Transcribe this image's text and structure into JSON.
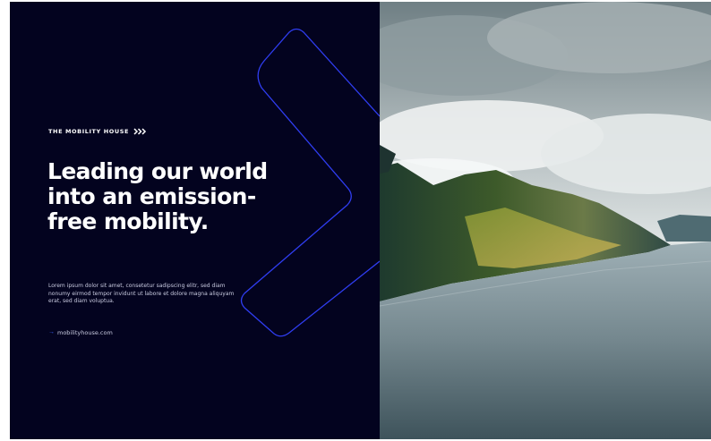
{
  "brand": {
    "name": "THE MOBILITY HOUSE",
    "logo_icon": "triple-chevron-icon"
  },
  "hero": {
    "headline": "Leading our world into an emission-free mobility.",
    "body": "Lorem ipsum dolor sit amet, consetetur sadipscing elitr, sed diam nonumy eirmod tempor invidunt ut labore et dolore magna aliquyam erat, sed diam voluptua."
  },
  "link": {
    "arrow_icon": "arrow-right-icon",
    "text": "mobilityhouse.com"
  },
  "photo": {
    "subject": "fjord-landscape-image"
  },
  "colors": {
    "panel_background": "#03031f",
    "accent_blue": "#2f3df0",
    "text": "#ffffff"
  }
}
